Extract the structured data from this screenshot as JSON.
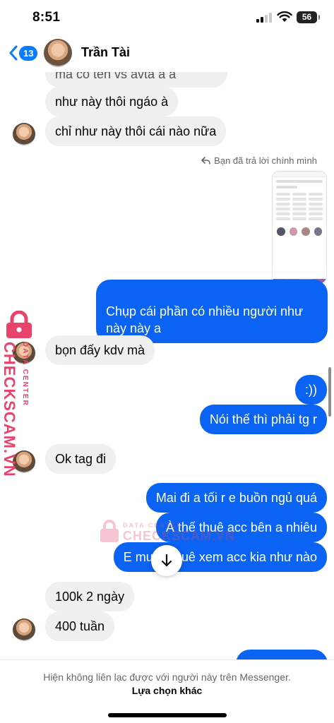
{
  "status_bar": {
    "time": "8:51",
    "battery": "56"
  },
  "header": {
    "unread_count": "13",
    "contact_name": "Trần Tài"
  },
  "messages": {
    "m0": "ma có tên vs avta à a",
    "m1": "như này thôi ngáo à",
    "m2": "chỉ như này thôi cái nào nữa",
    "reply_note": "Bạn đã trả lời chính mình",
    "m3": "Chụp cái phần có nhiều người như\nnày này a",
    "m4": "bọn đấy kdv mà",
    "m5": ":))",
    "m6": "Nói thế thì phải tg r",
    "m7": "Ok tag đi",
    "m8": "Mai đi a tối r e buồn ngủ quá",
    "m9": "À thế thuê acc bên a nhiêu",
    "m10": "E muốn thuê xem acc kia như nào",
    "m11": "100k 2 ngày",
    "m12": "400 tuần"
  },
  "watermark": {
    "brand": "CHECKSCAM.VN",
    "tag": "DATA CENTER"
  },
  "footer": {
    "notice": "Hiện không liên lạc được với người này trên Messenger.",
    "action": "Lựa chọn khác"
  },
  "colors": {
    "outgoing": "#0a63f2",
    "incoming": "#f0f0f0",
    "accent": "#0a7cff",
    "watermark": "#e8436a"
  }
}
